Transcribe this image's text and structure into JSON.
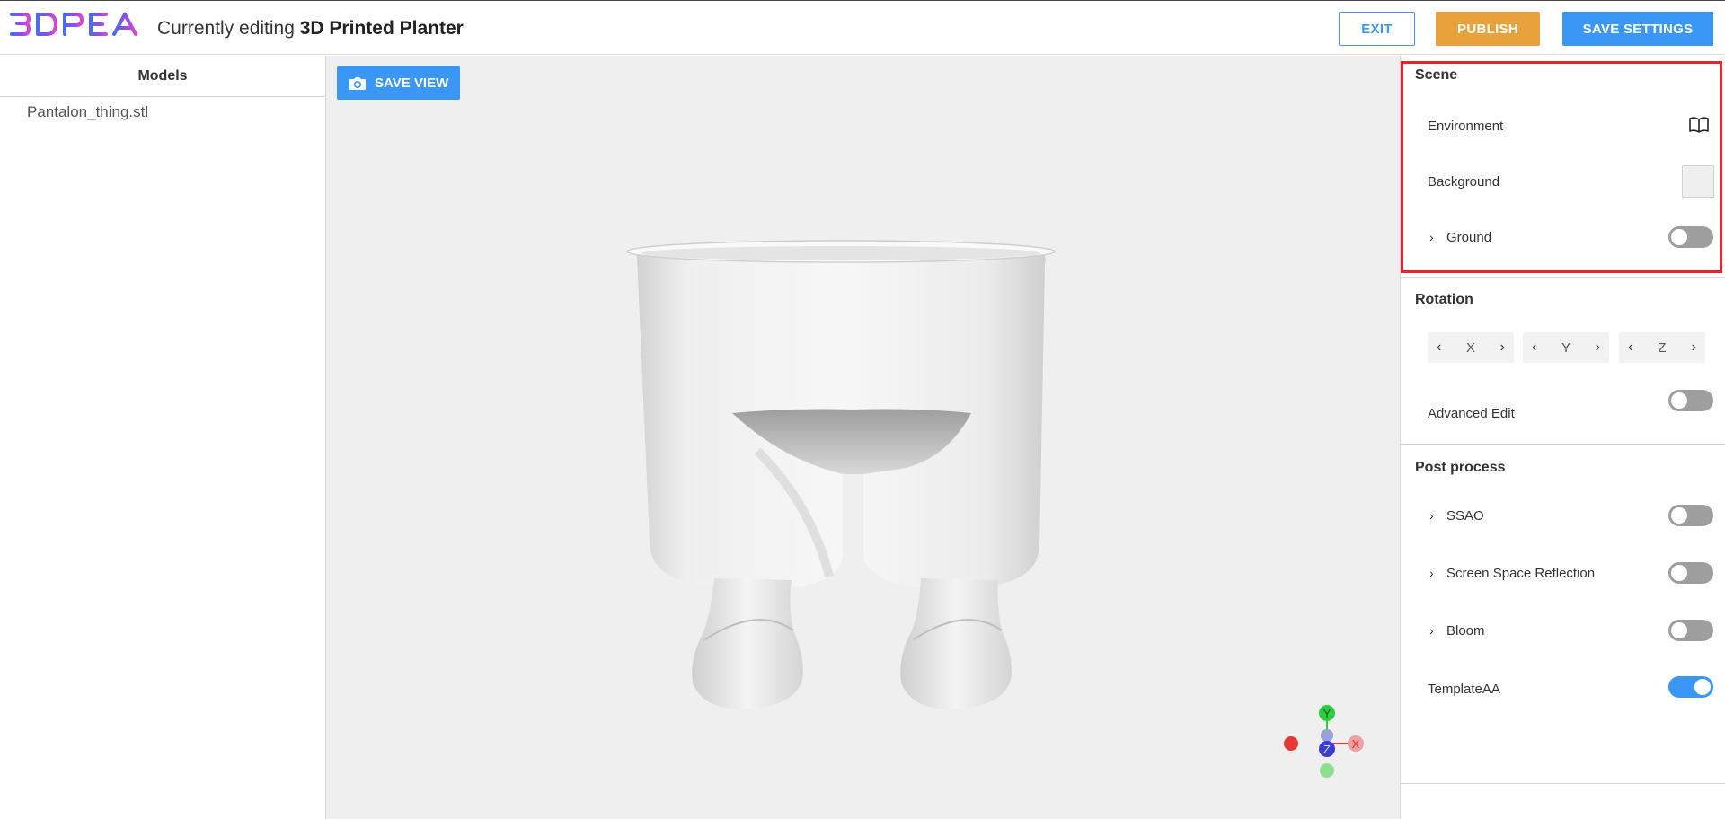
{
  "header": {
    "logo_text": "3DPEA",
    "editing_prefix": "Currently editing",
    "model_title": "3D Printed Planter",
    "exit_label": "EXIT",
    "publish_label": "PUBLISH",
    "save_settings_label": "SAVE SETTINGS"
  },
  "left_panel": {
    "heading": "Models",
    "items": [
      "Pantalon_thing.stl"
    ]
  },
  "viewport": {
    "save_view_label": "SAVE VIEW",
    "background_color": "#efefef",
    "gizmo": {
      "y_label": "Y",
      "x_label": "X",
      "z_label": "Z"
    }
  },
  "right_panel": {
    "scene": {
      "title": "Scene",
      "environment_label": "Environment",
      "background_label": "Background",
      "background_swatch": "#efefef",
      "ground_label": "Ground",
      "ground_on": false
    },
    "rotation": {
      "title": "Rotation",
      "axes": [
        "X",
        "Y",
        "Z"
      ],
      "advanced_edit_label": "Advanced Edit",
      "advanced_edit_on": false
    },
    "post_process": {
      "title": "Post process",
      "items": [
        {
          "label": "SSAO",
          "expandable": true,
          "on": false
        },
        {
          "label": "Screen Space Reflection",
          "expandable": true,
          "on": false
        },
        {
          "label": "Bloom",
          "expandable": true,
          "on": false
        },
        {
          "label": "TemplateAA",
          "expandable": false,
          "on": true
        }
      ]
    }
  },
  "colors": {
    "accent": "#3b97f5",
    "publish": "#e9a23b",
    "highlight": "#e8232f"
  }
}
